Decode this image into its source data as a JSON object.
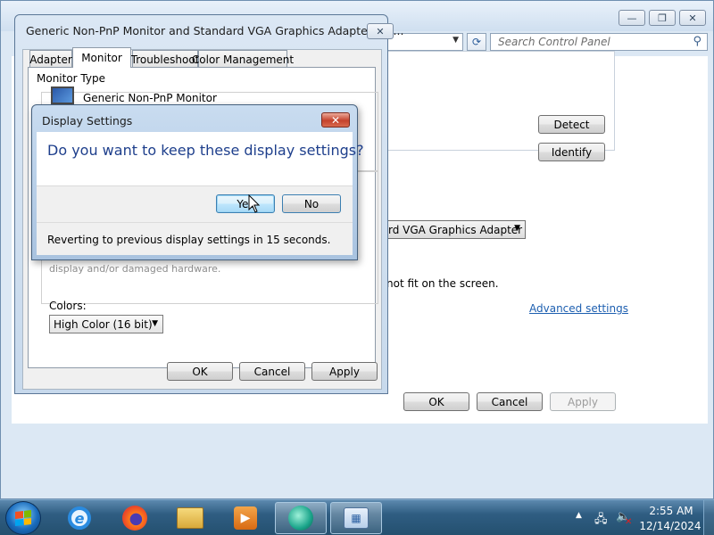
{
  "control_panel": {
    "minimize_glyph": "—",
    "maximize_glyph": "❐",
    "close_glyph": "✕",
    "search_placeholder": "Search Control Panel",
    "detect_label": "Detect",
    "identify_label": "Identify",
    "adapter_select_value": "rd VGA Graphics Adapter",
    "fit_text": "not fit on the screen.",
    "advanced_settings_link": "Advanced settings",
    "ok_label": "OK",
    "cancel_label": "Cancel",
    "apply_label": "Apply"
  },
  "properties_dialog": {
    "title": "Generic Non-PnP Monitor and Standard VGA Graphics Adapter Pro...",
    "close_glyph": "✕",
    "tabs": [
      {
        "label": "Adapter"
      },
      {
        "label": "Monitor"
      },
      {
        "label": "Troubleshoot"
      },
      {
        "label": "Color Management"
      }
    ],
    "active_tab": "Monitor",
    "monitor_type_label": "Monitor Type",
    "monitor_name": "Generic Non-PnP Monitor",
    "warning_text": "display and/or damaged hardware.",
    "colors_label": "Colors:",
    "colors_value": "High Color (16 bit)",
    "ok_label": "OK",
    "cancel_label": "Cancel",
    "apply_label": "Apply"
  },
  "display_settings_dialog": {
    "title": "Display Settings",
    "close_glyph": "✕",
    "question": "Do you want to keep these display settings?",
    "yes_label": "Yes",
    "no_label": "No",
    "revert_text": "Reverting to previous display settings in 15 seconds.",
    "revert_seconds": 15
  },
  "taskbar": {
    "items": [
      {
        "name": "Internet Explorer",
        "icon": "internet-explorer-icon"
      },
      {
        "name": "Firefox",
        "icon": "firefox-icon"
      },
      {
        "name": "Windows Explorer",
        "icon": "explorer-folder-icon"
      },
      {
        "name": "Windows Media Player",
        "icon": "media-player-icon"
      },
      {
        "name": "App",
        "icon": "app-icon"
      },
      {
        "name": "Control Panel",
        "icon": "control-panel-icon"
      }
    ],
    "ie_glyph": "e",
    "media_glyph": "▶",
    "cp_glyph": "▦",
    "clock_time": "2:55 AM",
    "clock_date": "12/14/2024"
  },
  "colors": {
    "question_text": "#1e3f8c",
    "link": "#1d5fb0",
    "taskbar": "#2f5d82"
  }
}
